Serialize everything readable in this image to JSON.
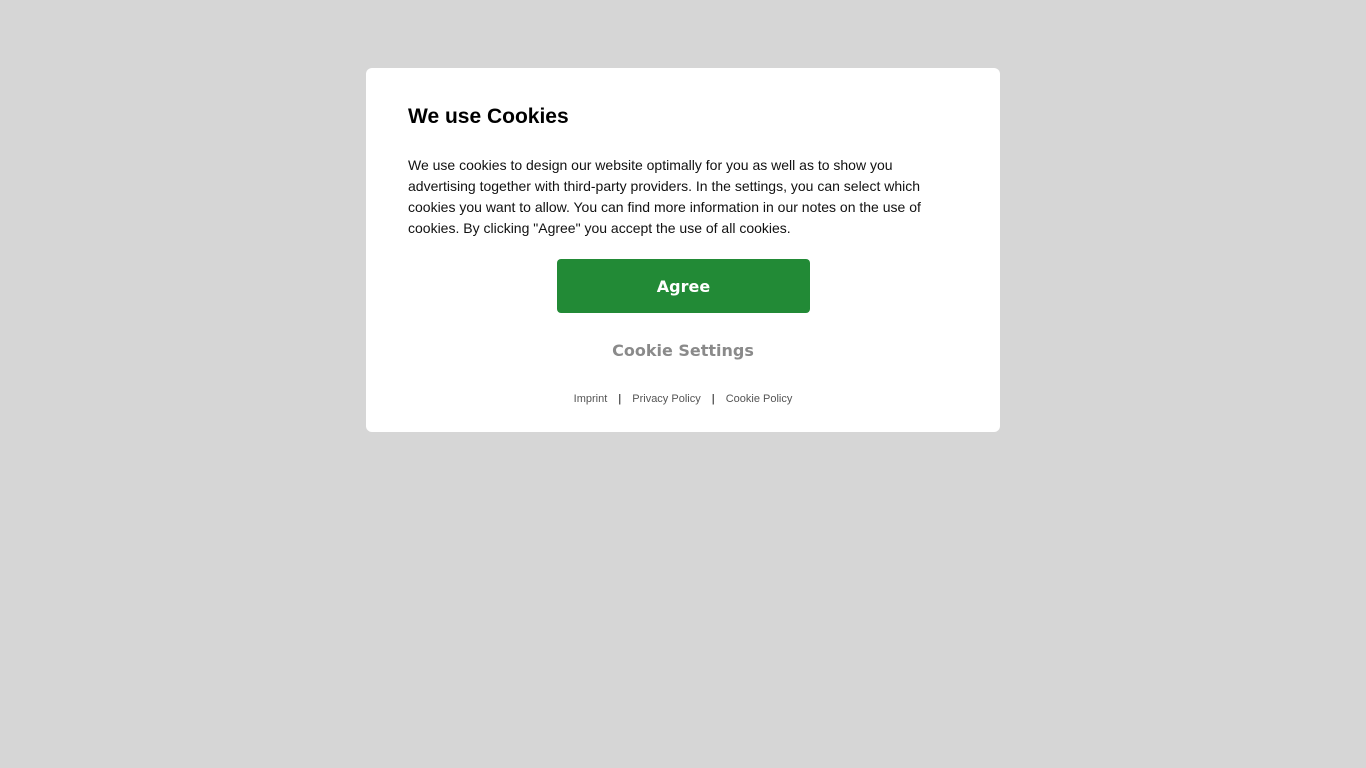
{
  "dialog": {
    "title": "We use Cookies",
    "body": "We use cookies to design our website optimally for you as well as to show you advertising together with third-party providers. In the settings, you can select which cookies you want to allow. You can find more information in our notes on the use of cookies. By clicking \"Agree\" you accept the use of all cookies.",
    "agree_label": "Agree",
    "settings_label": "Cookie Settings",
    "links": {
      "imprint": "Imprint",
      "privacy": "Privacy Policy",
      "cookie_policy": "Cookie Policy",
      "separator": "|"
    }
  },
  "colors": {
    "backdrop": "#d6d6d6",
    "dialog_bg": "#ffffff",
    "agree_bg": "#228a36",
    "settings_text": "#8a8a8a"
  }
}
